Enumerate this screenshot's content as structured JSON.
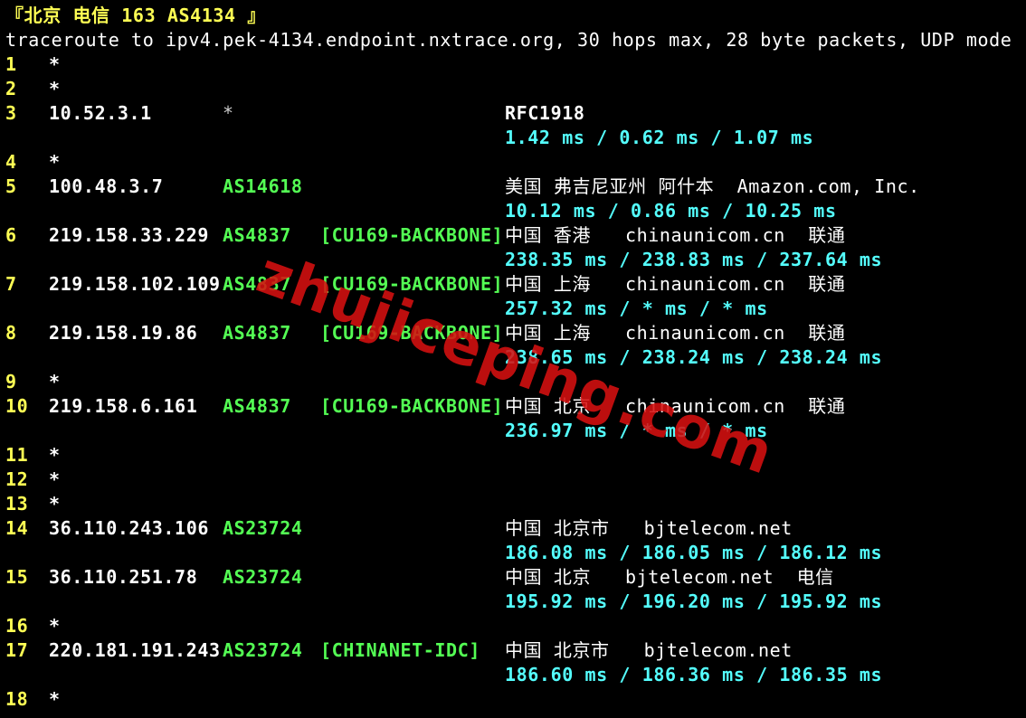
{
  "title": "『北京 电信 163 AS4134 』",
  "command": "traceroute to ipv4.pek-4134.endpoint.nxtrace.org, 30 hops max, 28 byte packets, UDP mode",
  "hops": [
    {
      "hop": "1",
      "ip": "*"
    },
    {
      "hop": "2",
      "ip": "*"
    },
    {
      "hop": "3",
      "ip": "10.52.3.1",
      "asn": "*",
      "geo": "RFC1918",
      "latency": "1.42 ms / 0.62 ms / 1.07 ms"
    },
    {
      "hop": "4",
      "ip": "*"
    },
    {
      "hop": "5",
      "ip": "100.48.3.7",
      "asn": "AS14618",
      "geo": "美国 弗吉尼亚州 阿什本  Amazon.com, Inc.",
      "latency": "10.12 ms / 0.86 ms / 10.25 ms"
    },
    {
      "hop": "6",
      "ip": "219.158.33.229",
      "asn": "AS4837",
      "tag": "[CU169-BACKBONE]",
      "geo": "中国 香港   chinaunicom.cn  联通",
      "latency": "238.35 ms / 238.83 ms / 237.64 ms"
    },
    {
      "hop": "7",
      "ip": "219.158.102.109",
      "asn": "AS4837",
      "tag": "[CU169-BACKBONE]",
      "geo": "中国 上海   chinaunicom.cn  联通",
      "latency": "257.32 ms / * ms / * ms"
    },
    {
      "hop": "8",
      "ip": "219.158.19.86",
      "asn": "AS4837",
      "tag": "[CU169-BACKBONE]",
      "geo": "中国 上海   chinaunicom.cn  联通",
      "latency": "238.65 ms / 238.24 ms / 238.24 ms"
    },
    {
      "hop": "9",
      "ip": "*"
    },
    {
      "hop": "10",
      "ip": "219.158.6.161",
      "asn": "AS4837",
      "tag": "[CU169-BACKBONE]",
      "geo": "中国 北京   chinaunicom.cn  联通",
      "latency": "236.97 ms / * ms / * ms"
    },
    {
      "hop": "11",
      "ip": "*"
    },
    {
      "hop": "12",
      "ip": "*"
    },
    {
      "hop": "13",
      "ip": "*"
    },
    {
      "hop": "14",
      "ip": "36.110.243.106",
      "asn": "AS23724",
      "geo": "中国 北京市   bjtelecom.net",
      "latency": "186.08 ms / 186.05 ms / 186.12 ms"
    },
    {
      "hop": "15",
      "ip": "36.110.251.78",
      "asn": "AS23724",
      "geo": "中国 北京   bjtelecom.net  电信",
      "latency": "195.92 ms / 196.20 ms / 195.92 ms"
    },
    {
      "hop": "16",
      "ip": "*"
    },
    {
      "hop": "17",
      "ip": "220.181.191.243",
      "asn": "AS23724",
      "tag": "[CHINANET-IDC]",
      "geo": "中国 北京市   bjtelecom.net",
      "latency": "186.60 ms / 186.36 ms / 186.35 ms"
    },
    {
      "hop": "18",
      "ip": "*"
    }
  ],
  "watermark": "zhujiceping.com",
  "colors": {
    "background": "#000000",
    "hop_number": "#ffff54",
    "asn": "#54ff54",
    "latency": "#54ffff",
    "text": "#ffffff",
    "watermark": "#d61010"
  }
}
